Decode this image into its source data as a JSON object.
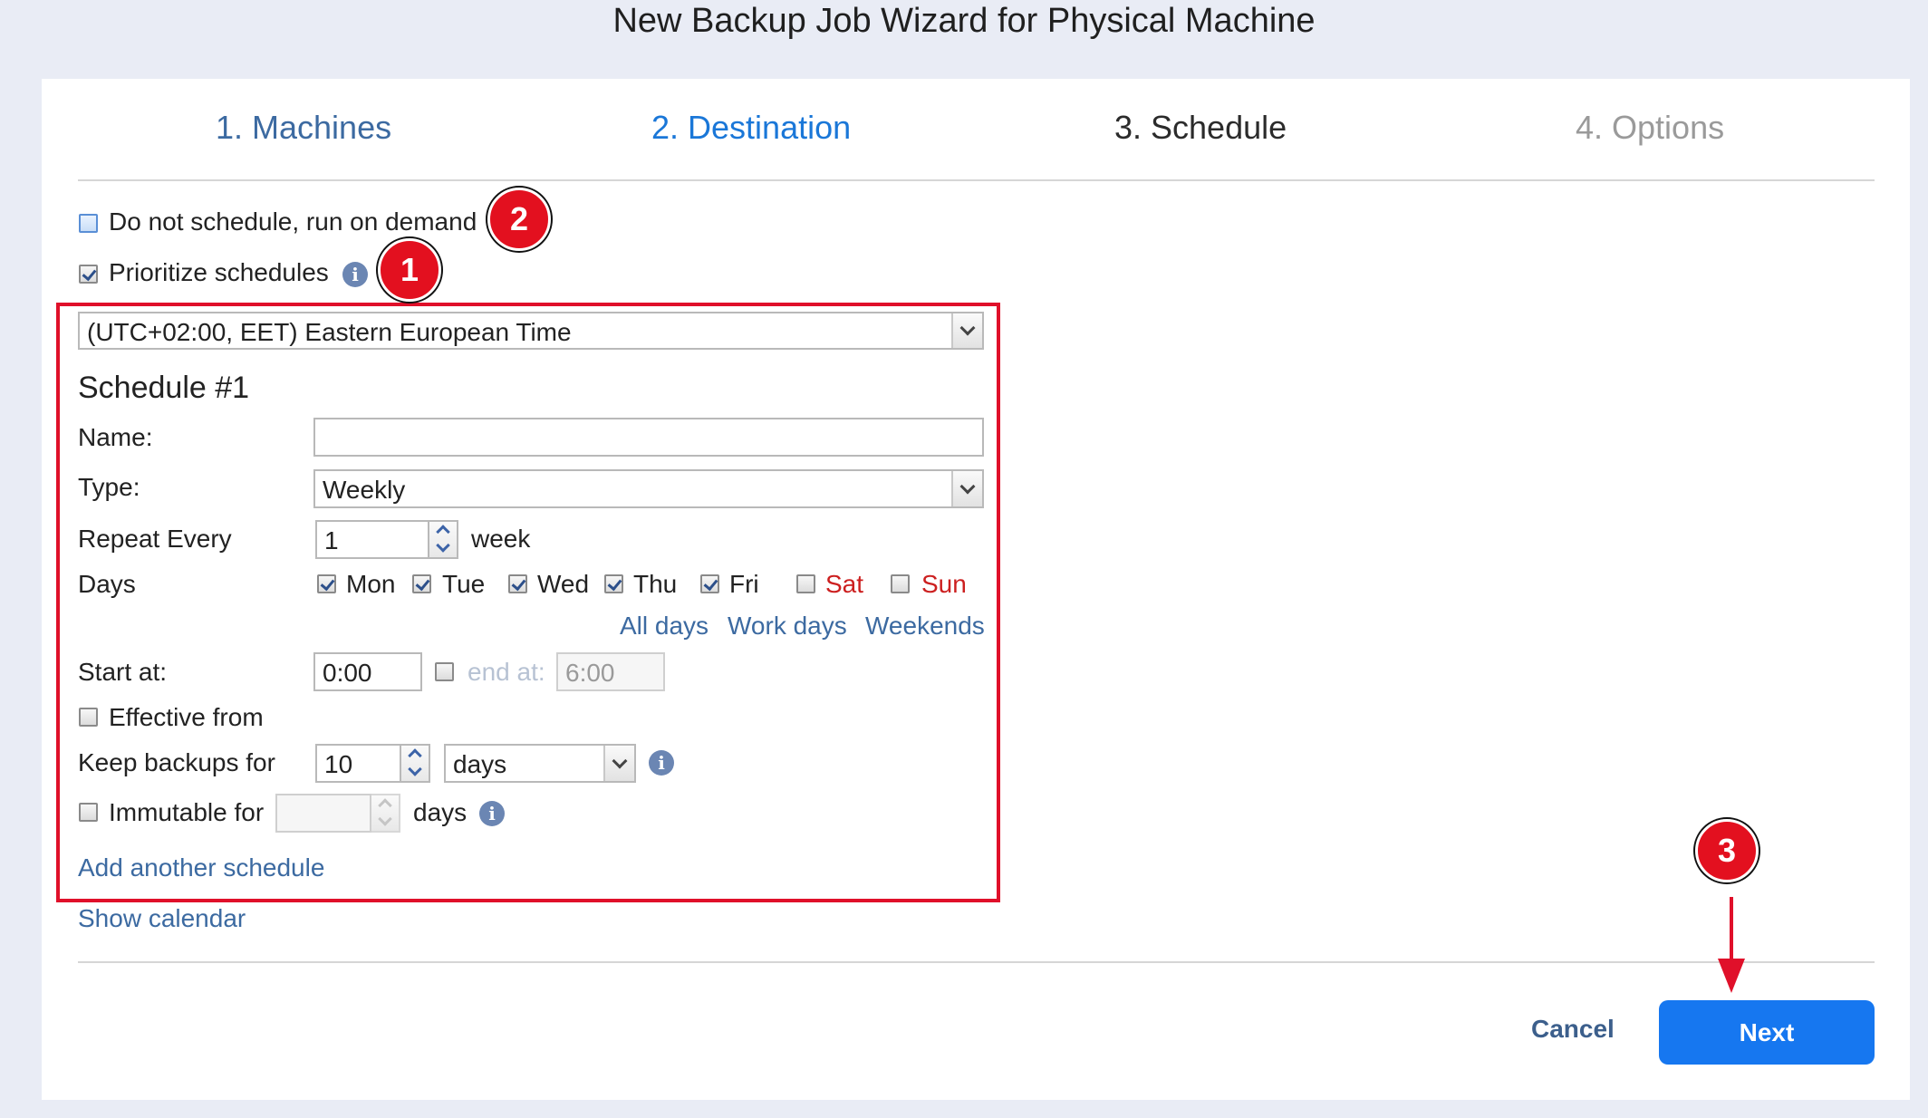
{
  "window": {
    "title": "New Backup Job Wizard for Physical Machine"
  },
  "steps": [
    {
      "label": "1. Machines",
      "color": "#3c6aa1"
    },
    {
      "label": "2. Destination",
      "color": "#1a77d8"
    },
    {
      "label": "3. Schedule",
      "color": "#2b2b2b"
    },
    {
      "label": "4. Options",
      "color": "#9a9a9a"
    }
  ],
  "options": {
    "do_not_schedule_label": "Do not schedule, run on demand",
    "do_not_schedule_checked": false,
    "prioritize_label": "Prioritize schedules",
    "prioritize_checked": true
  },
  "timezone": {
    "value": "(UTC+02:00, EET) Eastern European Time"
  },
  "schedule": {
    "heading": "Schedule #1",
    "name_label": "Name:",
    "name_value": "",
    "type_label": "Type:",
    "type_value": "Weekly",
    "repeat_label": "Repeat Every",
    "repeat_value": "1",
    "repeat_unit": "week",
    "days_label": "Days",
    "days": [
      {
        "label": "Mon",
        "checked": true,
        "weekend": false
      },
      {
        "label": "Tue",
        "checked": true,
        "weekend": false
      },
      {
        "label": "Wed",
        "checked": true,
        "weekend": false
      },
      {
        "label": "Thu",
        "checked": true,
        "weekend": false
      },
      {
        "label": "Fri",
        "checked": true,
        "weekend": false
      },
      {
        "label": "Sat",
        "checked": false,
        "weekend": true
      },
      {
        "label": "Sun",
        "checked": false,
        "weekend": true
      }
    ],
    "day_links": {
      "all": "All days",
      "work": "Work days",
      "weekends": "Weekends"
    },
    "start_label": "Start at:",
    "start_value": "0:00",
    "end_label": "end at:",
    "end_value": "6:00",
    "end_checked": false,
    "effective_label": "Effective from",
    "effective_checked": false,
    "keep_label": "Keep backups for",
    "keep_value": "10",
    "keep_unit": "days",
    "immutable_label": "Immutable for",
    "immutable_checked": false,
    "immutable_value": "",
    "immutable_unit": "days",
    "add_another": "Add another schedule"
  },
  "show_calendar": "Show calendar",
  "footer": {
    "cancel": "Cancel",
    "next": "Next"
  },
  "annotations": {
    "badge1": "1",
    "badge2": "2",
    "badge3": "3"
  },
  "colors": {
    "accent": "#1677f0",
    "highlight": "#e0102a",
    "link": "#3c6aa1",
    "weekend": "#cc1f1f"
  }
}
